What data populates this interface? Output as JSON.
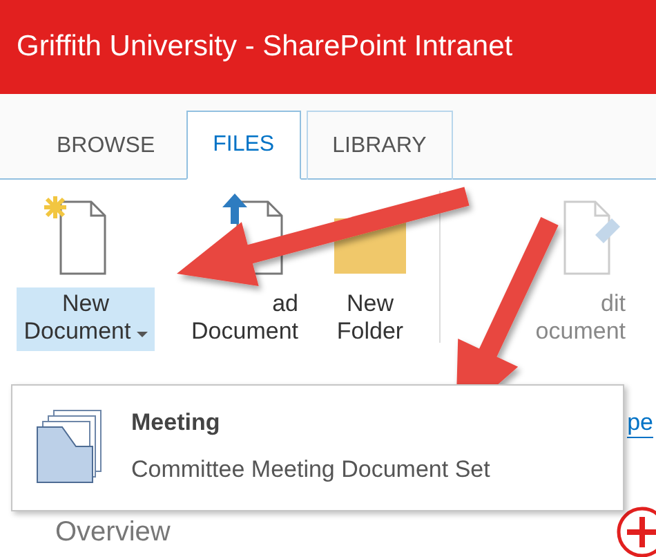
{
  "window": {
    "title": "Griffith University - SharePoint Intranet"
  },
  "tabs": [
    {
      "label": "BROWSE",
      "selected": false
    },
    {
      "label": "FILES",
      "selected": true
    },
    {
      "label": "LIBRARY",
      "selected": false
    }
  ],
  "ribbon": {
    "buttons": [
      {
        "kind": "new",
        "lines": [
          "New",
          "Document"
        ],
        "dropdown": true,
        "highlighted": true,
        "disabled": false
      },
      {
        "kind": "upload",
        "lines": [
          "ad",
          "Document"
        ],
        "dropdown": false,
        "highlighted": false,
        "disabled": false
      },
      {
        "kind": "folder",
        "lines": [
          "New",
          "Folder"
        ],
        "dropdown": false,
        "highlighted": false,
        "disabled": false
      },
      {
        "kind": "edit",
        "lines": [
          "dit",
          "ocument"
        ],
        "dropdown": false,
        "highlighted": false,
        "disabled": true
      }
    ]
  },
  "menu": {
    "items": [
      {
        "title": "Meeting",
        "description": "Committee Meeting Document Set"
      }
    ]
  },
  "content": {
    "link_fragment": "pe",
    "heading": "Overview"
  }
}
